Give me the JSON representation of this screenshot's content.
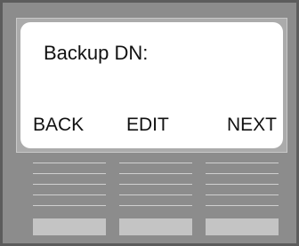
{
  "display": {
    "prompt": "Backup DN:",
    "softkeys": {
      "left": "BACK",
      "middle": "EDIT",
      "right": "NEXT"
    }
  },
  "colors": {
    "housing": "#8c8c8c",
    "housing_border": "#5c5c5c",
    "screen": "#ffffff",
    "text": "#111111",
    "key": "#c4c4c4"
  }
}
